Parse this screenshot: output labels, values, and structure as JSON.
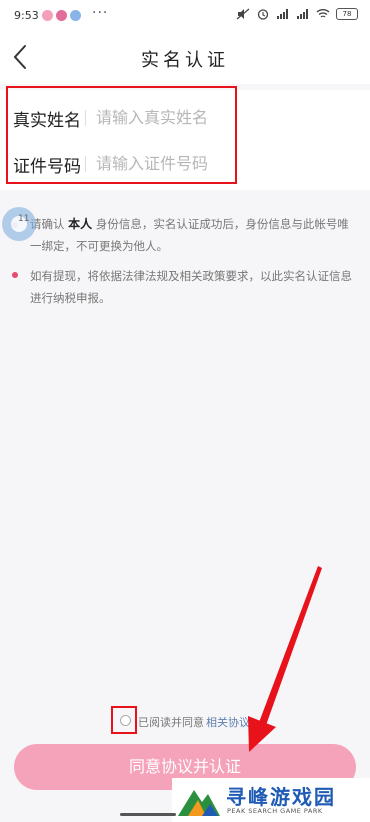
{
  "status_bar": {
    "time": "9:53",
    "dots": "···",
    "battery": "78"
  },
  "header": {
    "title": "实名认证"
  },
  "form": {
    "name_label": "真实姓名",
    "name_placeholder": "请输入真实姓名",
    "id_label": "证件号码",
    "id_placeholder": "请输入证件号码"
  },
  "notices": {
    "touch_index": "11",
    "n1_prefix": "请确认",
    "n1_bold": "本人",
    "n1_suffix": "身份信息，实名认证成功后，身份信息与此帐号唯一绑定，不可更换为他人。",
    "n2": "如有提现，将依据法律法规及相关政策要求，以此实名认证信息进行纳税申报。"
  },
  "agreement": {
    "text": "已阅读并同意",
    "link": "相关协议"
  },
  "submit_label": "同意协议并认证",
  "watermark": {
    "title": "寻峰游戏园",
    "subtitle": "PEAK SEARCH GAME PARK"
  },
  "colors": {
    "accent_pink": "#f5a3bb",
    "annotation_red": "#e8121b",
    "link_blue": "#5d7fb0"
  }
}
